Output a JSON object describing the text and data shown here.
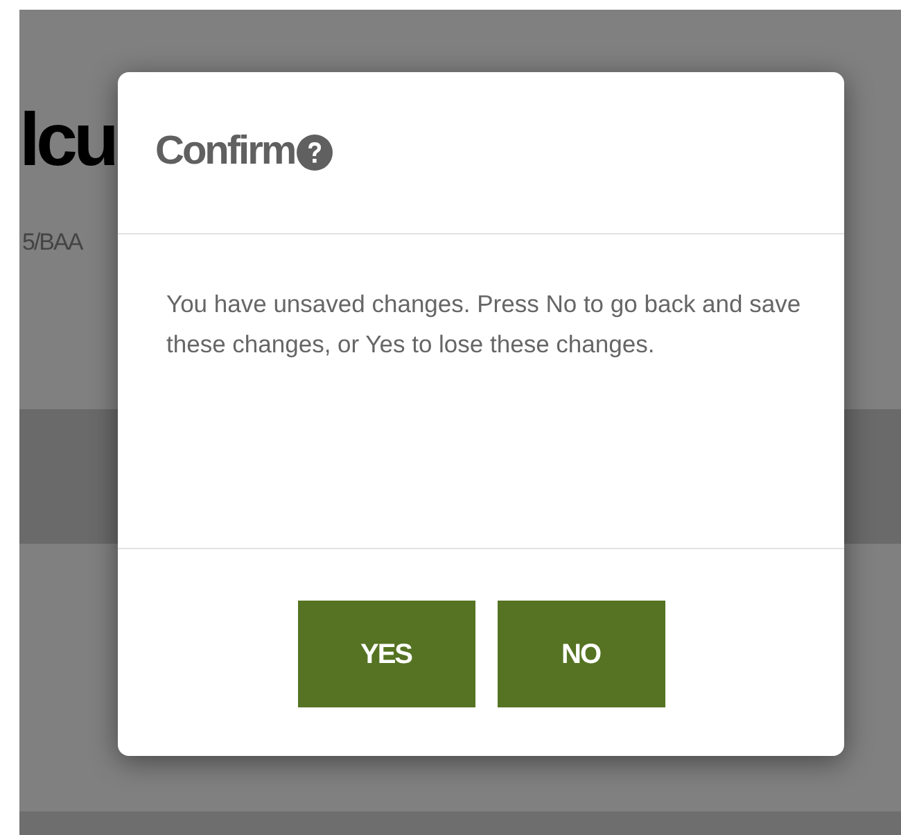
{
  "page": {
    "heading": "lcu",
    "subtitle": "5/BAA"
  },
  "dialog": {
    "title": "Confirm",
    "message": "You have unsaved changes. Press No to go back and save these changes, or Yes to lose these changes.",
    "buttons": [
      {
        "label": "YES"
      },
      {
        "label": "NO"
      }
    ]
  }
}
